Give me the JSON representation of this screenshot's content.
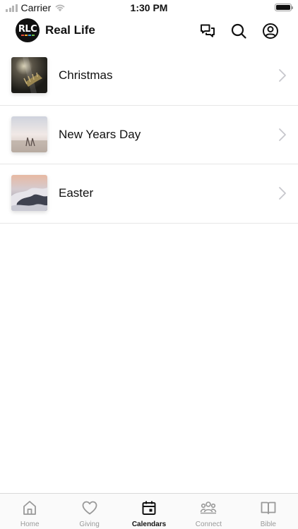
{
  "status_bar": {
    "carrier": "Carrier",
    "time": "1:30 PM"
  },
  "header": {
    "logo_text": "RLC",
    "title": "Real Life",
    "icons": [
      "chat-icon",
      "search-icon",
      "profile-icon"
    ]
  },
  "list": {
    "items": [
      {
        "label": "Christmas",
        "thumb": "christmas-image"
      },
      {
        "label": "New Years Day",
        "thumb": "new-years-image"
      },
      {
        "label": "Easter",
        "thumb": "easter-image"
      }
    ]
  },
  "tabbar": {
    "tabs": [
      {
        "label": "Home",
        "icon": "home-icon",
        "active": false
      },
      {
        "label": "Giving",
        "icon": "heart-icon",
        "active": false
      },
      {
        "label": "Calendars",
        "icon": "calendar-icon",
        "active": true
      },
      {
        "label": "Connect",
        "icon": "group-icon",
        "active": false
      },
      {
        "label": "Bible",
        "icon": "book-icon",
        "active": false
      }
    ]
  },
  "colors": {
    "text": "#111111",
    "inactive_tab": "#999999",
    "divider": "#e6e6e6",
    "chevron": "#c7c7cc"
  }
}
